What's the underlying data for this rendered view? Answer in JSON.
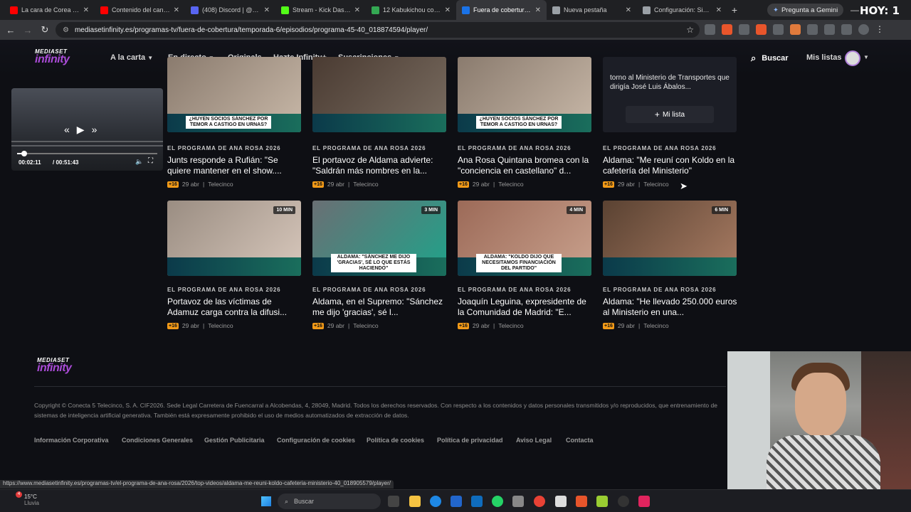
{
  "browser": {
    "tabs": [
      {
        "title": "La cara de Corea del S",
        "color": "#ff0000"
      },
      {
        "title": "Contenido del canal -",
        "color": "#ff0000"
      },
      {
        "title": "(408) Discord | @Saix",
        "color": "#5865f2"
      },
      {
        "title": "Stream - Kick Dashbo",
        "color": "#53fc18"
      },
      {
        "title": "12 Kabukichou con N",
        "color": "#34a853"
      },
      {
        "title": "Fuera de cobertura: P",
        "color": "#1a73e8"
      },
      {
        "title": "Nueva pestaña",
        "color": "#9aa0a6"
      },
      {
        "title": "Configuración: Sistem",
        "color": "#9aa0a6"
      }
    ],
    "active_tab": 5,
    "gemini_label": "Pregunta a Gemini",
    "overlay_text": "HOY: 1",
    "url": "mediasetinfinity.es/programas-tv/fuera-de-cobertura/temporada-6/episodios/programa-45-40_018874594/player/"
  },
  "site": {
    "logo_top": "MEDIASET",
    "logo_bottom": "infinity",
    "menu": [
      "A la carta",
      "En directo",
      "Originals",
      "Hazte Infinity+",
      "Suscripciones"
    ],
    "menu_has_caret": [
      true,
      true,
      false,
      false,
      true
    ],
    "search_label": "Buscar",
    "lists_label": "Mis listas"
  },
  "player": {
    "current_time": "00:02:11",
    "total_time": "/ 00:51:43",
    "progress": 0.042
  },
  "side_item": {
    "description": "torno al Ministerio de Transportes que dirigía José Luis Ábalos...",
    "add_list_label": "Mi lista"
  },
  "cards_row1": [
    {
      "program": "EL PROGRAMA DE ANA ROSA 2026",
      "title": "Junts responde a Rufián: \"Se quiere mantener en el show....",
      "age": "+16",
      "date": "29 abr",
      "channel": "Telecinco",
      "caption": "¿HUYEN SOCIOS SÁNCHEZ POR TEMOR A CASTIGO EN URNAS?",
      "duration": ""
    },
    {
      "program": "EL PROGRAMA DE ANA ROSA 2026",
      "title": "El portavoz de Aldama advierte: \"Saldrán más nombres en la...",
      "age": "+16",
      "date": "29 abr",
      "channel": "Telecinco",
      "caption": "",
      "duration": ""
    },
    {
      "program": "EL PROGRAMA DE ANA ROSA 2026",
      "title": "Ana Rosa Quintana bromea con la \"conciencia en castellano\" d...",
      "age": "+16",
      "date": "29 abr",
      "channel": "Telecinco",
      "caption": "¿HUYEN SOCIOS SÁNCHEZ POR TEMOR A CASTIGO EN URNAS?",
      "duration": ""
    },
    {
      "program": "EL PROGRAMA DE ANA ROSA 2026",
      "title": "Aldama: \"Me reuní con Koldo en la cafetería del Ministerio\"",
      "age": "+16",
      "date": "29 abr",
      "channel": "Telecinco",
      "caption": "",
      "duration": ""
    }
  ],
  "cards_row2": [
    {
      "program": "EL PROGRAMA DE ANA ROSA 2026",
      "title": "Portavoz de las víctimas de Adamuz carga contra la difusi...",
      "age": "+16",
      "date": "29 abr",
      "channel": "Telecinco",
      "caption": "",
      "duration": "10 MIN"
    },
    {
      "program": "EL PROGRAMA DE ANA ROSA 2026",
      "title": "Aldama, en el Supremo: \"Sánchez me dijo 'gracias', sé l...",
      "age": "+16",
      "date": "29 abr",
      "channel": "Telecinco",
      "caption": "ALDAMA: \"SÁNCHEZ ME DIJO 'GRACIAS', SÉ LO QUE ESTÁS HACIENDO\"",
      "duration": "3 MIN"
    },
    {
      "program": "EL PROGRAMA DE ANA ROSA 2026",
      "title": "Joaquín Leguina, expresidente de la Comunidad de Madrid: \"E...",
      "age": "+16",
      "date": "29 abr",
      "channel": "Telecinco",
      "caption": "ALDAMA: \"KOLDO DIJO QUE NECESITAMOS FINANCIACIÓN DEL PARTIDO\"",
      "duration": "4 MIN"
    },
    {
      "program": "EL PROGRAMA DE ANA ROSA 2026",
      "title": "Aldama: \"He llevado 250.000 euros al Ministerio en una...",
      "age": "+16",
      "date": "29 abr",
      "channel": "Telecinco",
      "caption": "",
      "duration": "6 MIN"
    }
  ],
  "footer": {
    "copyright": "Copyright © Conecta 5 Telecinco, S. A. CIF2026. Sede Legal Carretera de Fuencarral a Alcobendas, 4, 28049, Madrid. Todos los derechos reservados. Con respecto a los contenidos y datos personales transmitidos y/o reproducidos, que entrenamiento de sistemas de inteligencia artificial generativa. También está expresamente prohibido el uso de medios automatizados de extracción de datos.",
    "links": [
      "Información Corporativa",
      "Condiciones Generales",
      "Gestión Publicitaria",
      "Configuración de cookies",
      "Política de cookies",
      "Política de privacidad",
      "Aviso Legal",
      "Contacta"
    ]
  },
  "status_url": "https://www.mediasetinfinity.es/programas-tv/el-programa-de-ana-rosa/2026/top-videos/aldama-me-reuni-koldo-cafeteria-ministerio-40_018905579/player/",
  "taskbar": {
    "temperature": "15°C",
    "weather_sub": "Lluvia",
    "notification_count": "4",
    "search_placeholder": "Buscar"
  },
  "colors": {
    "accent": "#a94bd6",
    "age_badge": "#f29a18",
    "background": "#0e0f14"
  }
}
